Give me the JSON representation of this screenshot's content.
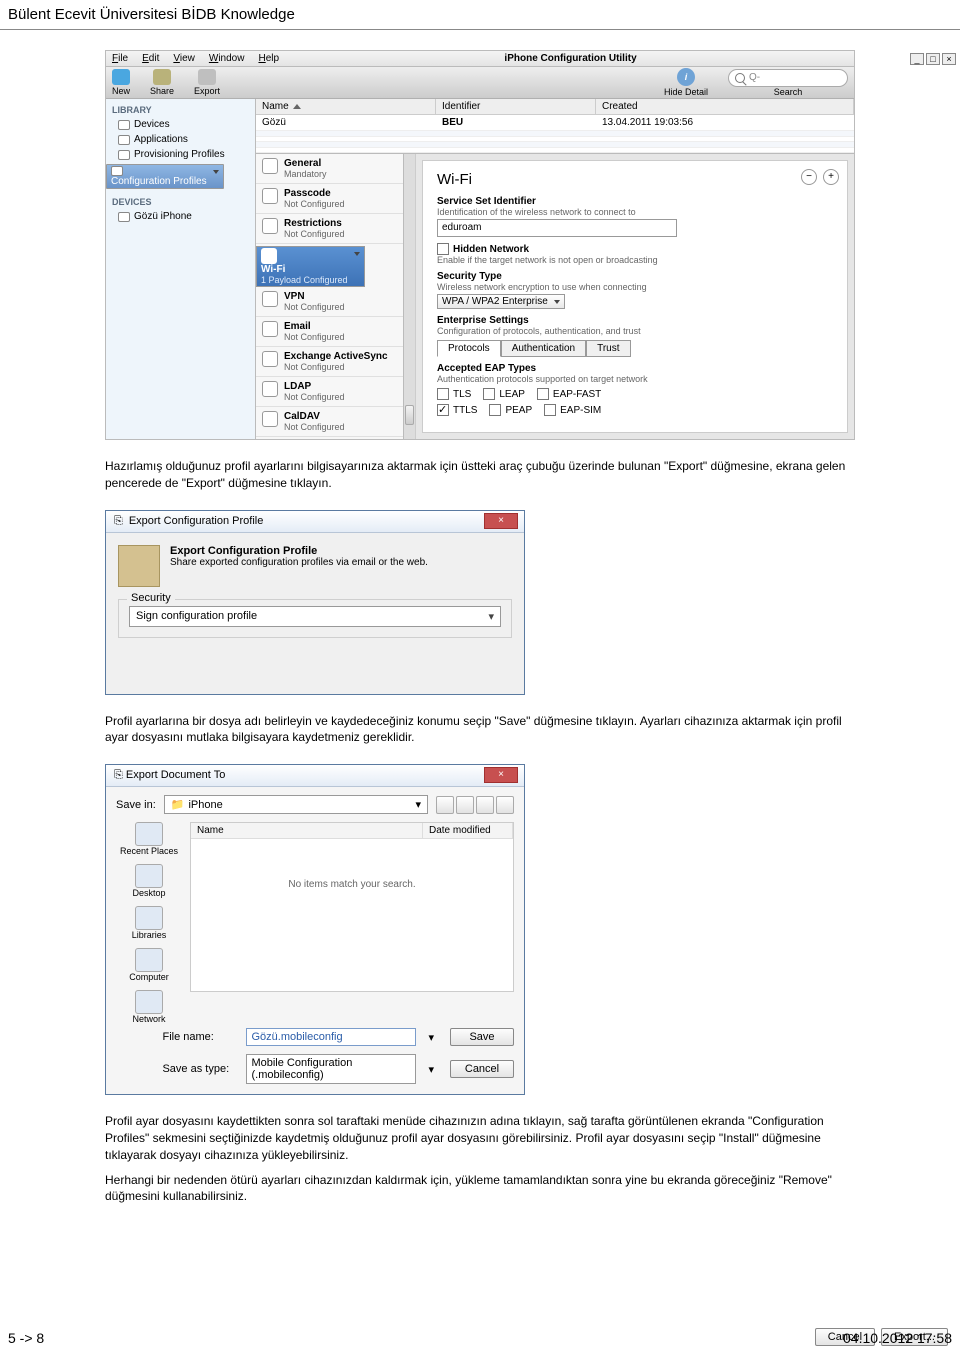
{
  "page": {
    "header": "Bülent Ecevit Üniversitesi BİDB Knowledge",
    "footer_left": "5 -> 8",
    "footer_right": "04.10.2012 17:58"
  },
  "ss1": {
    "title": "iPhone Configuration Utility",
    "menu": {
      "file": "File",
      "edit": "Edit",
      "view": "View",
      "window": "Window",
      "help": "Help"
    },
    "toolbar": {
      "new": "New",
      "share": "Share",
      "export": "Export",
      "hide": "Hide Detail",
      "search": "Search"
    },
    "side": {
      "library": "LIBRARY",
      "devices_lbl": "Devices",
      "applications": "Applications",
      "provisioning": "Provisioning Profiles",
      "conf": "Configuration Profiles",
      "devices_h": "DEVICES",
      "device1": "Gözü iPhone"
    },
    "grid": {
      "cols": {
        "name": "Name",
        "ident": "Identifier",
        "created": "Created"
      },
      "row1": {
        "name": "Gözü",
        "ident": "BEU",
        "created": "13.04.2011 19:03:56"
      }
    },
    "paylist": {
      "general": {
        "t": "General",
        "s": "Mandatory"
      },
      "passcode": {
        "t": "Passcode",
        "s": "Not Configured"
      },
      "restrictions": {
        "t": "Restrictions",
        "s": "Not Configured"
      },
      "wifi": {
        "t": "Wi-Fi",
        "s": "1 Payload Configured"
      },
      "vpn": {
        "t": "VPN",
        "s": "Not Configured"
      },
      "email": {
        "t": "Email",
        "s": "Not Configured"
      },
      "eas": {
        "t": "Exchange ActiveSync",
        "s": "Not Configured"
      },
      "ldap": {
        "t": "LDAP",
        "s": "Not Configured"
      },
      "caldav": {
        "t": "CalDAV",
        "s": "Not Configured"
      }
    },
    "detail": {
      "heading": "Wi-Fi",
      "ssid": {
        "l": "Service Set Identifier",
        "d": "Identification of the wireless network to connect to",
        "v": "eduroam"
      },
      "hidden": {
        "l": "Hidden Network",
        "d": "Enable if the target network is not open or broadcasting"
      },
      "sectype": {
        "l": "Security Type",
        "d": "Wireless network encryption to use when connecting",
        "v": "WPA / WPA2 Enterprise"
      },
      "ent": {
        "l": "Enterprise Settings",
        "d": "Configuration of protocols, authentication, and trust"
      },
      "tabs": {
        "p": "Protocols",
        "a": "Authentication",
        "t": "Trust"
      },
      "eap": {
        "l": "Accepted EAP Types",
        "d": "Authentication protocols supported on target network",
        "tls": "TLS",
        "leap": "LEAP",
        "eapfast": "EAP-FAST",
        "ttls": "TTLS",
        "peap": "PEAP",
        "eapsim": "EAP-SIM"
      }
    }
  },
  "p1": "Hazırlamış olduğunuz profil ayarlarını bilgisayarınıza aktarmak için üstteki araç çubuğu üzerinde bulunan \"Export\" düğmesine, ekrana gelen pencerede de \"Export\" düğmesine tıklayın.",
  "ss2": {
    "title": "Export Configuration Profile",
    "h": "Export Configuration Profile",
    "sub": "Share exported configuration profiles via email or the web.",
    "security": "Security",
    "sign": "Sign configuration profile",
    "cancel": "Cancel",
    "export": "Export..."
  },
  "p2": "Profil ayarlarına bir dosya adı belirleyin ve kaydedeceğiniz konumu seçip \"Save\" düğmesine tıklayın. Ayarları cihazınıza aktarmak için profil ayar dosyasını mutlaka bilgisayara kaydetmeniz gereklidir.",
  "ss3": {
    "title": "Export Document To",
    "savein": "Save in:",
    "folder": "iPhone",
    "col_name": "Name",
    "col_date": "Date modified",
    "noitems": "No items match your search.",
    "places": {
      "recent": "Recent Places",
      "desktop": "Desktop",
      "libraries": "Libraries",
      "computer": "Computer",
      "network": "Network"
    },
    "filename_l": "File name:",
    "filename_v": "Gözü.mobileconfig",
    "type_l": "Save as type:",
    "type_v": "Mobile Configuration (.mobileconfig)",
    "save": "Save",
    "cancel": "Cancel"
  },
  "p3": "Profil ayar dosyasını kaydettikten sonra sol taraftaki menüde cihazınızın adına tıklayın, sağ tarafta görüntülenen ekranda \"Configuration Profiles\" sekmesini seçtiğinizde kaydetmiş olduğunuz profil ayar dosyasını görebilirsiniz. Profil ayar dosyasını seçip \"Install\" düğmesine tıklayarak dosyayı cihazınıza yükleyebilirsiniz.",
  "p4": "Herhangi bir nedenden ötürü ayarları cihazınızdan kaldırmak için, yükleme tamamlandıktan sonra yine bu ekranda göreceğiniz \"Remove\" düğmesini kullanabilirsiniz."
}
